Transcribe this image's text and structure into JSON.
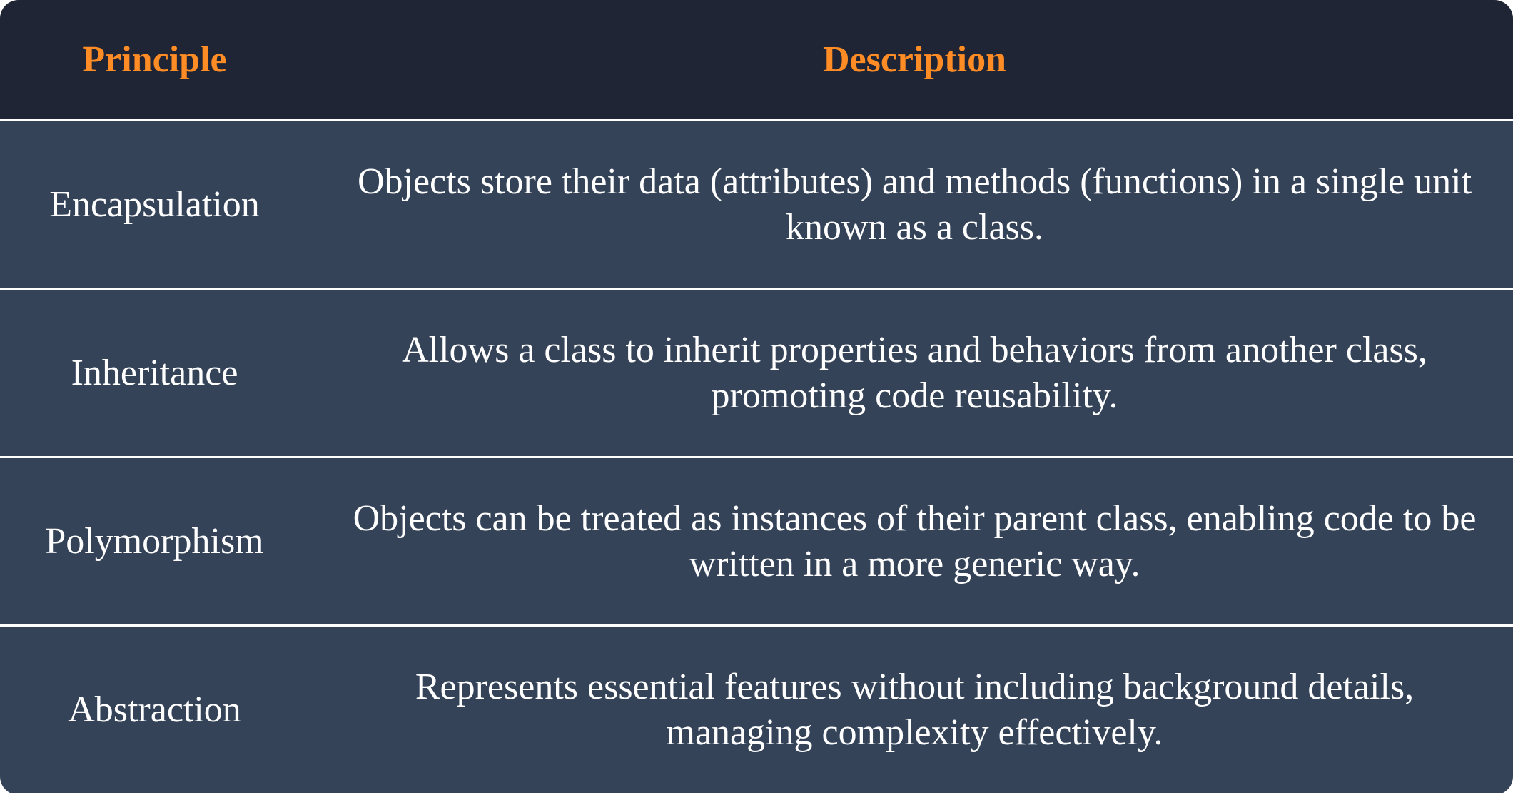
{
  "header": {
    "principle": "Principle",
    "description": "Description"
  },
  "rows": [
    {
      "principle": "Encapsulation",
      "description": "Objects store their data (attributes) and methods (functions) in a single unit known as a class."
    },
    {
      "principle": "Inheritance",
      "description": "Allows a class to inherit properties and behaviors from another class, promoting code reusability."
    },
    {
      "principle": "Polymorphism",
      "description": "Objects can be treated as instances of their parent class, enabling code to be written in a more generic way."
    },
    {
      "principle": "Abstraction",
      "description": "Represents essential features without including background details, managing complexity effectively."
    }
  ],
  "colors": {
    "header_bg": "#1f2535",
    "row_bg": "#354358",
    "header_text": "#ff8c24",
    "text": "#ffffff"
  }
}
